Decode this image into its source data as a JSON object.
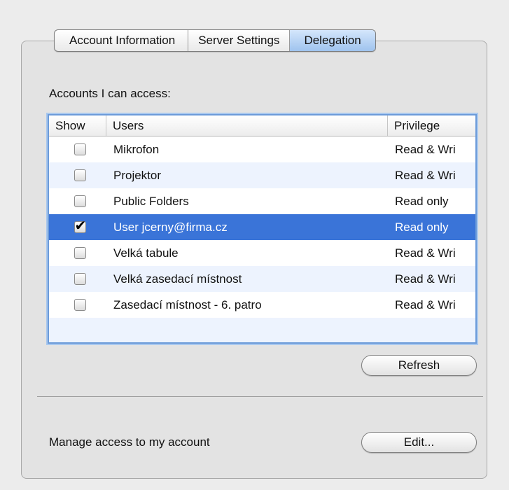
{
  "tabs": [
    {
      "label": "Account Information"
    },
    {
      "label": "Server Settings"
    },
    {
      "label": "Delegation",
      "active": true
    }
  ],
  "accounts_label": "Accounts I can access:",
  "table": {
    "columns": [
      "Show",
      "Users",
      "Privilege"
    ],
    "rows": [
      {
        "show": false,
        "user": "Mikrofon",
        "privilege": "Read & Wri"
      },
      {
        "show": false,
        "user": "Projektor",
        "privilege": "Read & Wri"
      },
      {
        "show": false,
        "user": "Public Folders",
        "privilege": "Read only"
      },
      {
        "show": true,
        "user": "User jcerny@firma.cz",
        "privilege": "Read only",
        "selected": true
      },
      {
        "show": false,
        "user": "Velká tabule",
        "privilege": "Read & Wri"
      },
      {
        "show": false,
        "user": "Velká zasedací místnost",
        "privilege": "Read & Wri"
      },
      {
        "show": false,
        "user": "Zasedací místnost - 6. patro",
        "privilege": "Read & Wri"
      }
    ]
  },
  "refresh_label": "Refresh",
  "manage_label": "Manage access to my account",
  "edit_label": "Edit...",
  "colors": {
    "selection": "#3a74d8",
    "focus_ring": "#6c9bd9",
    "alt_row": "#edf3fe"
  }
}
